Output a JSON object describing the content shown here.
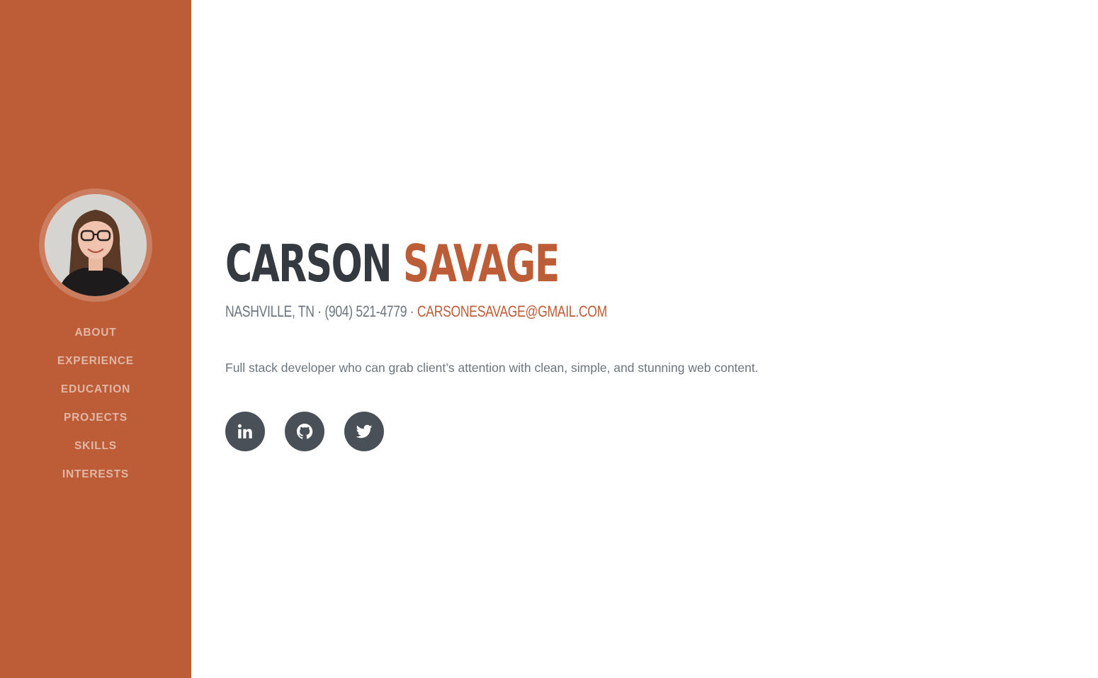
{
  "sidebar": {
    "background": "#bd5d38",
    "avatar_alt": "Profile photo",
    "nav": [
      {
        "label": "About"
      },
      {
        "label": "Experience"
      },
      {
        "label": "Education"
      },
      {
        "label": "Projects"
      },
      {
        "label": "Skills"
      },
      {
        "label": "Interests"
      }
    ]
  },
  "header": {
    "first_name": "Carson",
    "last_name": "Savage",
    "location": "Nashville, TN",
    "separator": "·",
    "phone": "(904) 521-4779",
    "email": "carsonesavage@gmail.com"
  },
  "about": {
    "lead": "Full stack developer who can grab client’s attention with clean, simple, and stunning web content."
  },
  "social": [
    {
      "name": "linkedin-icon"
    },
    {
      "name": "github-icon"
    },
    {
      "name": "twitter-icon"
    }
  ],
  "colors": {
    "accent": "#bd5d38",
    "dark": "#343a40",
    "muted": "#6c757d",
    "social_bg": "#495057"
  }
}
